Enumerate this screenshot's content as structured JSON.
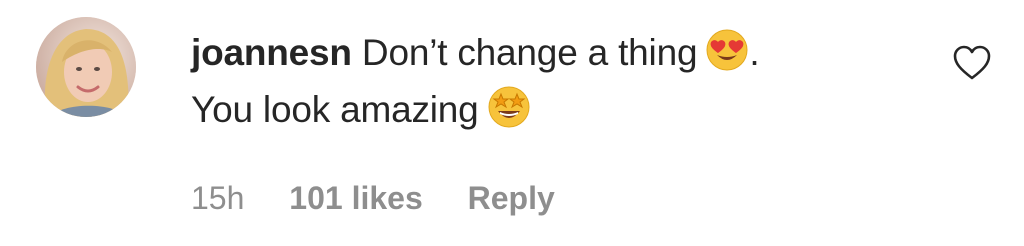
{
  "comment": {
    "username": "joannesn",
    "text_line1": "Don’t change a thing",
    "text_after_emoji": ".",
    "text_line2": "You look amazing",
    "emoji_1": "heart-eyes-emoji",
    "emoji_2": "star-struck-emoji"
  },
  "meta": {
    "time": "15h",
    "likes": "101 likes",
    "reply": "Reply"
  },
  "icons": {
    "like": "heart-outline-icon"
  },
  "colors": {
    "text": "#262626",
    "secondary": "#8e8e8e",
    "emoji_face": "#f7c33b",
    "heart_eyes": "#e53935"
  }
}
